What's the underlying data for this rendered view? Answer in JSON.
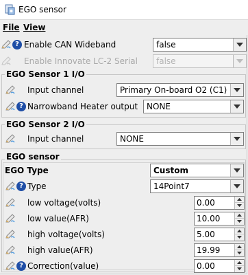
{
  "window": {
    "title": "EGO sensor"
  },
  "menu": {
    "file_label": "File",
    "view_label": "View"
  },
  "top": {
    "enable_can_label": "Enable CAN Wideband",
    "enable_can_value": "false",
    "enable_innovate_label": "Enable Innovate LC-2 Serial",
    "enable_innovate_value": "false"
  },
  "sensor1": {
    "title": "EGO Sensor 1 I/O",
    "input_label": "Input channel",
    "input_value": "Primary On-board O2 (C1)",
    "heater_label": "Narrowband Heater output",
    "heater_value": "NONE"
  },
  "sensor2": {
    "title": "EGO Sensor 2 I/O",
    "input_label": "Input channel",
    "input_value": "NONE"
  },
  "ego": {
    "title": "EGO sensor",
    "ego_type_label": "EGO Type",
    "ego_type_value": "Custom",
    "type_label": "Type",
    "type_value": "14Point7",
    "low_voltage_label": "low voltage(volts)",
    "low_voltage_value": "0.00",
    "low_value_label": "low value(AFR)",
    "low_value_value": "10.00",
    "high_voltage_label": "high voltage(volts)",
    "high_voltage_value": "5.00",
    "high_value_label": "high value(AFR)",
    "high_value_value": "19.99",
    "correction_label": "Correction(value)",
    "correction_value": "0.00"
  },
  "colors": {
    "help_icon": "#1f4ea6",
    "background": "#eeeeee",
    "border": "#7f7f7f"
  },
  "icons": [
    "app-icon",
    "pen-icon",
    "help-icon",
    "chevron-down-icon",
    "spin-up-icon",
    "spin-down-icon"
  ]
}
